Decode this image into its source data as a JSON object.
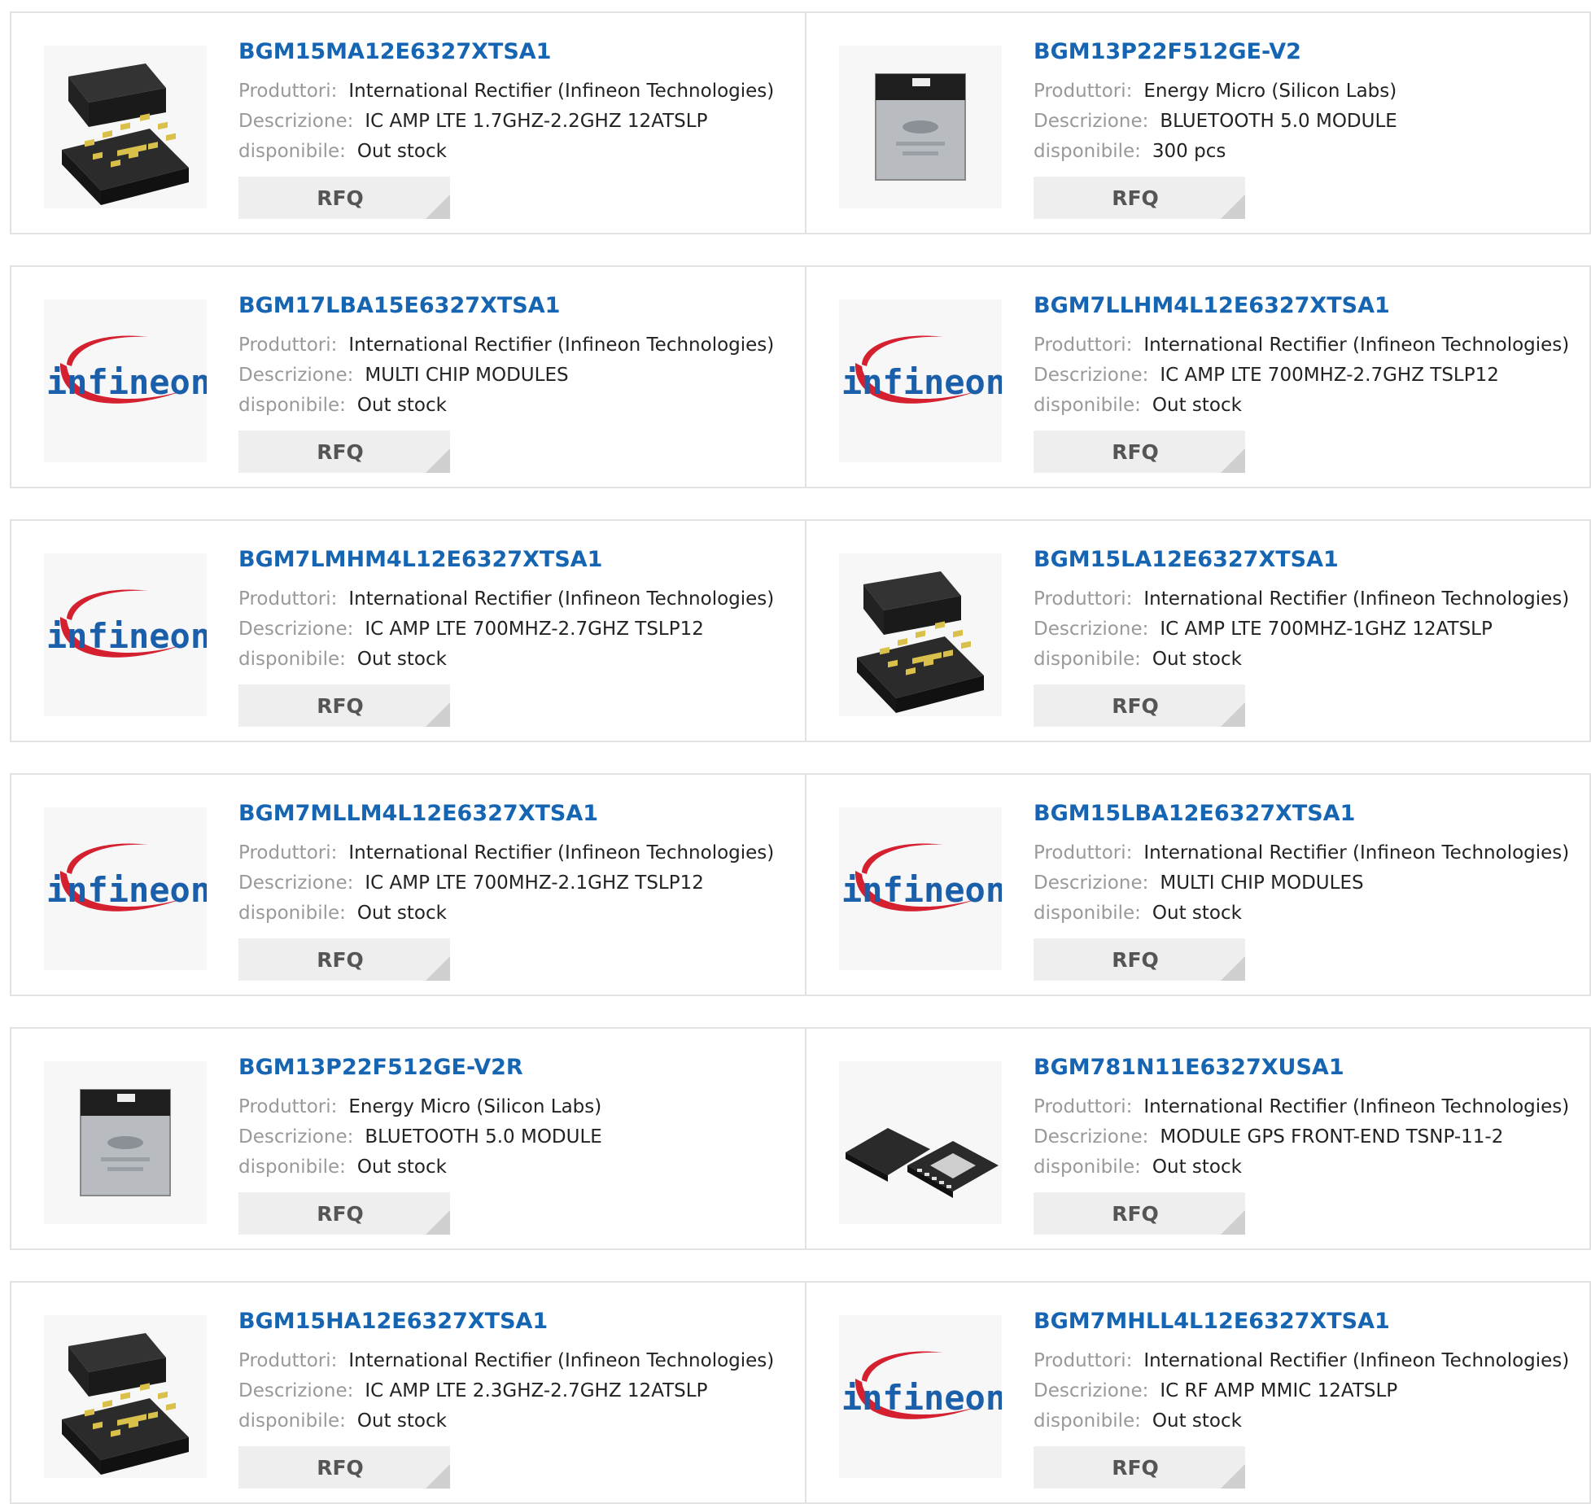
{
  "labels": {
    "manufacturer": "Produttori:",
    "description": "Descrizione:",
    "availability": "disponibile:",
    "rfq": "RFQ"
  },
  "products": [
    {
      "part": "BGM15MA12E6327XTSA1",
      "manufacturer": "International Rectifier (Infineon Technologies)",
      "description": "IC AMP LTE 1.7GHZ-2.2GHZ 12ATSLP",
      "availability": "Out stock",
      "image": "tslp-chip-image"
    },
    {
      "part": "BGM13P22F512GE-V2",
      "manufacturer": "Energy Micro (Silicon Labs)",
      "description": "BLUETOOTH 5.0 MODULE",
      "availability": "300 pcs",
      "image": "silicon-labs-module-image"
    },
    {
      "part": "BGM17LBA15E6327XTSA1",
      "manufacturer": "International Rectifier (Infineon Technologies)",
      "description": "MULTI CHIP MODULES",
      "availability": "Out stock",
      "image": "infineon-logo"
    },
    {
      "part": "BGM7LLHM4L12E6327XTSA1",
      "manufacturer": "International Rectifier (Infineon Technologies)",
      "description": "IC AMP LTE 700MHZ-2.7GHZ TSLP12",
      "availability": "Out stock",
      "image": "infineon-logo"
    },
    {
      "part": "BGM7LMHM4L12E6327XTSA1",
      "manufacturer": "International Rectifier (Infineon Technologies)",
      "description": "IC AMP LTE 700MHZ-2.7GHZ TSLP12",
      "availability": "Out stock",
      "image": "infineon-logo"
    },
    {
      "part": "BGM15LA12E6327XTSA1",
      "manufacturer": "International Rectifier (Infineon Technologies)",
      "description": "IC AMP LTE 700MHZ-1GHZ 12ATSLP",
      "availability": "Out stock",
      "image": "tslp-chip-image"
    },
    {
      "part": "BGM7MLLM4L12E6327XTSA1",
      "manufacturer": "International Rectifier (Infineon Technologies)",
      "description": "IC AMP LTE 700MHZ-2.1GHZ TSLP12",
      "availability": "Out stock",
      "image": "infineon-logo"
    },
    {
      "part": "BGM15LBA12E6327XTSA1",
      "manufacturer": "International Rectifier (Infineon Technologies)",
      "description": "MULTI CHIP MODULES",
      "availability": "Out stock",
      "image": "infineon-logo"
    },
    {
      "part": "BGM13P22F512GE-V2R",
      "manufacturer": "Energy Micro (Silicon Labs)",
      "description": "BLUETOOTH 5.0 MODULE",
      "availability": "Out stock",
      "image": "silicon-labs-module-image"
    },
    {
      "part": "BGM781N11E6327XUSA1",
      "manufacturer": "International Rectifier (Infineon Technologies)",
      "description": "MODULE GPS FRONT-END TSNP-11-2",
      "availability": "Out stock",
      "image": "tsnp-chip-image"
    },
    {
      "part": "BGM15HA12E6327XTSA1",
      "manufacturer": "International Rectifier (Infineon Technologies)",
      "description": "IC AMP LTE 2.3GHZ-2.7GHZ 12ATSLP",
      "availability": "Out stock",
      "image": "tslp-chip-image"
    },
    {
      "part": "BGM7MHLL4L12E6327XTSA1",
      "manufacturer": "International Rectifier (Infineon Technologies)",
      "description": "IC RF AMP MMIC 12ATSLP",
      "availability": "Out stock",
      "image": "infineon-logo"
    }
  ],
  "logo_text": "infineon",
  "colors": {
    "part_link": "#1565b3",
    "label": "#999999",
    "rfq_bg": "#eeeeee",
    "infineon_blue": "#1b5faa",
    "infineon_red": "#d4202f"
  }
}
